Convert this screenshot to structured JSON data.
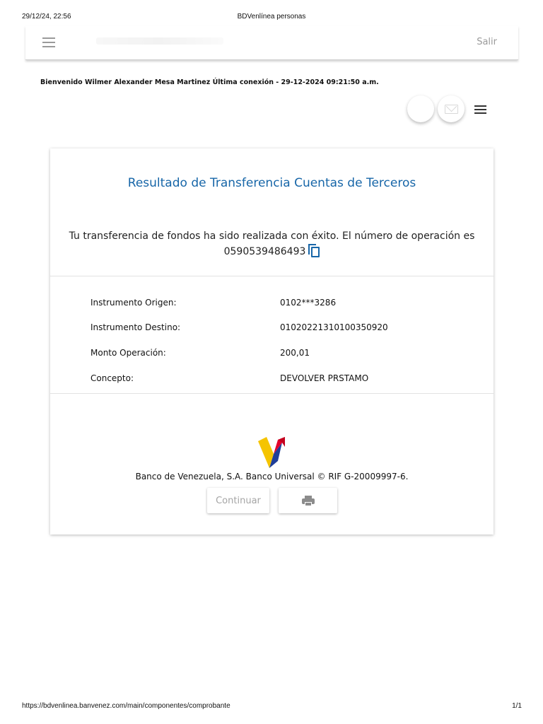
{
  "print_header": {
    "datetime": "29/12/24, 22:56",
    "page_title": "BDVenlínea personas"
  },
  "app_bar": {
    "exit_label": "Salir"
  },
  "welcome_text": "Bienvenido Wilmer Alexander Mesa Martinez Última conexión - 29-12-2024 09:21:50 a.m.",
  "result": {
    "heading": "Resultado de Transferencia Cuentas de Terceros",
    "message_line1": "Tu transferencia de fondos ha sido realizada con éxito. El número de operación es",
    "operation_number": "0590539486493",
    "details": [
      {
        "label": "Instrumento Origen:",
        "value": "0102***3286"
      },
      {
        "label": "Instrumento Destino:",
        "value": "01020221310100350920"
      },
      {
        "label": "Monto Operación:",
        "value": "200,01"
      },
      {
        "label": "Concepto:",
        "value": "DEVOLVER PRSTAMO"
      }
    ],
    "bank_footer": "Banco de Venezuela, S.A. Banco Universal © RIF G-20009997-6.",
    "continue_label": "Continuar"
  },
  "print_footer": {
    "url": "https://bdvenlinea.banvenez.com/main/componentes/comprobante",
    "page_count": "1/1"
  },
  "colors": {
    "accent_blue": "#1766a8",
    "logo_yellow": "#f5c400",
    "logo_red": "#e4002b",
    "logo_blue": "#1f3f99"
  },
  "icons": [
    "menu-icon",
    "envelope-icon",
    "hamburger-icon",
    "copy-icon",
    "bank-logo",
    "print-icon"
  ]
}
